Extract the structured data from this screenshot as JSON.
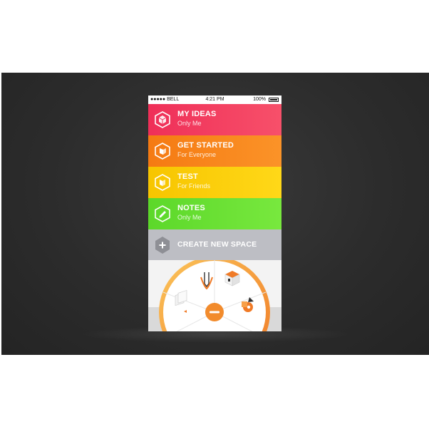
{
  "status_bar": {
    "carrier": "●●●●● BELL",
    "time": "4:21 PM",
    "battery": "100%"
  },
  "spaces": [
    {
      "title": "MY IDEAS",
      "subtitle": "Only Me",
      "icon": "cube-icon"
    },
    {
      "title": "GET STARTED",
      "subtitle": "For Everyone",
      "icon": "cube-icon"
    },
    {
      "title": "TEST",
      "subtitle": "For Friends",
      "icon": "cube-icon"
    },
    {
      "title": "NOTES",
      "subtitle": "Only Me",
      "icon": "pencil-icon"
    }
  ],
  "create_space": {
    "label": "CREATE NEW SPACE",
    "icon": "plus-icon"
  },
  "wheel": {
    "items": [
      "pin-icon",
      "box-icon",
      "shapes-icon",
      "pages-icon"
    ],
    "center": "minus-icon"
  },
  "colors": {
    "my_ideas": "#ef2f58",
    "get_started": "#f57a12",
    "test": "#f7c500",
    "notes": "#5cd82a",
    "create": "#bdbec4",
    "accent_orange": "#f39a3a"
  }
}
